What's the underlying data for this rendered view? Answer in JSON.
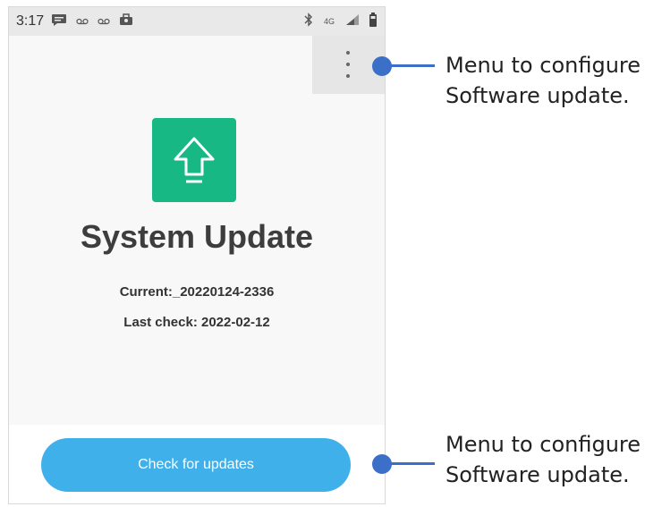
{
  "status_bar": {
    "time": "3:17",
    "left_icons": [
      "message-icon",
      "voicemail-icon",
      "voicemail-icon",
      "briefcase-icon"
    ],
    "right_icons": [
      "bluetooth-icon",
      "lte-4g-icon",
      "signal-icon",
      "battery-icon"
    ],
    "network_label": "4G"
  },
  "app": {
    "title": "System Update",
    "current": "Current:_20220124-2336",
    "last_check": "Last check: 2022-02-12",
    "check_button_label": "Check for updates",
    "menu_icon": "more-vert-icon",
    "app_icon": "upload-arrow-icon"
  },
  "callouts": {
    "top": {
      "line1": "Menu to configure",
      "line2": "Software update."
    },
    "bottom": {
      "line1": "Menu to configure",
      "line2": "Software update."
    }
  },
  "colors": {
    "app_icon_bg": "#17b884",
    "button_bg": "#3fb0ea",
    "callout": "#3c6fc8"
  }
}
